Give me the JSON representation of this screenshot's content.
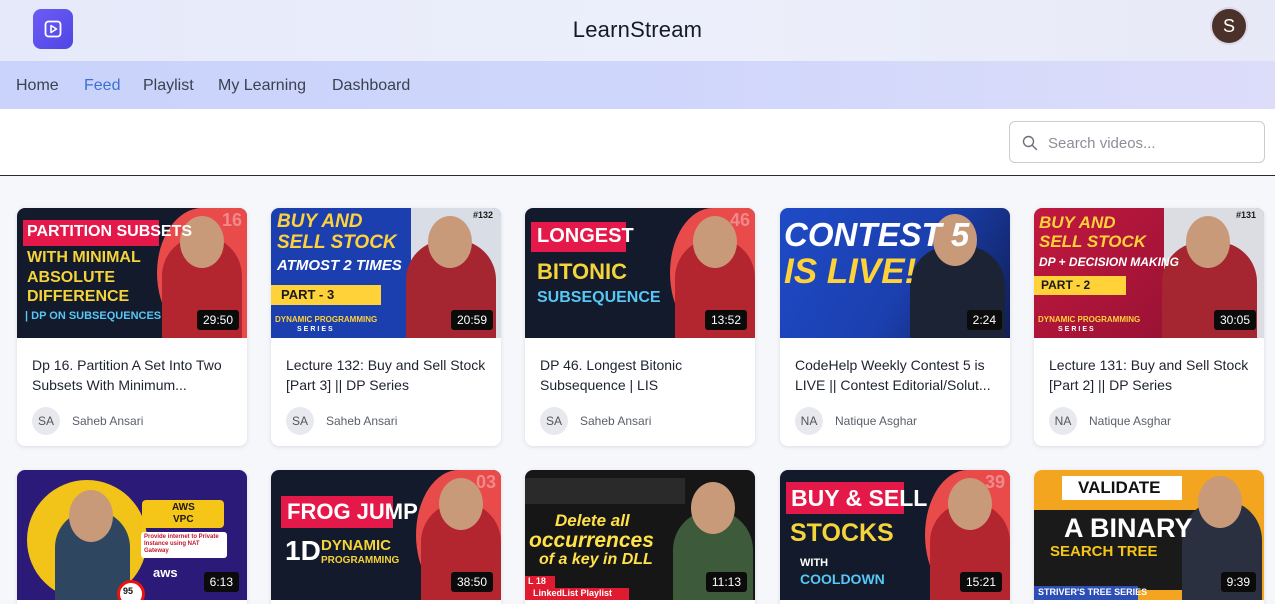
{
  "app": {
    "title": "LearnStream",
    "user_initial": "S"
  },
  "nav": {
    "items": [
      "Home",
      "Feed",
      "Playlist",
      "My Learning",
      "Dashboard"
    ],
    "active": "Feed"
  },
  "search": {
    "placeholder": "Search videos..."
  },
  "icons": {
    "logo": "play-square-icon",
    "search": "search-icon"
  },
  "colors": {
    "brand": "#5b4cf0",
    "nav_active": "#3d6fd6"
  },
  "videos": [
    {
      "title": "Dp 16. Partition A Set Into Two Subsets With Minimum...",
      "duration": "29:50",
      "channel_initials": "SA",
      "channel": "Saheb Ansari",
      "thumb_text": [
        "PARTITION SUBSETS",
        "WITH MINIMAL",
        "ABSOLUTE",
        "DIFFERENCE",
        "| DP ON SUBSEQUENCES"
      ],
      "thumb_num": "16"
    },
    {
      "title": "Lecture 132: Buy and Sell Stock [Part 3] || DP Series",
      "duration": "20:59",
      "channel_initials": "SA",
      "channel": "Saheb Ansari",
      "thumb_text": [
        "BUY AND",
        "SELL STOCK",
        "ATMOST 2 TIMES",
        "PART - 3",
        "DYNAMIC PROGRAMMING",
        "SERIES"
      ],
      "thumb_num": "#132"
    },
    {
      "title": "DP 46. Longest Bitonic Subsequence | LIS",
      "duration": "13:52",
      "channel_initials": "SA",
      "channel": "Saheb Ansari",
      "thumb_text": [
        "LONGEST",
        "BITONIC",
        "SUBSEQUENCE"
      ],
      "thumb_num": "46"
    },
    {
      "title": "CodeHelp Weekly Contest 5 is LIVE || Contest Editorial/Solut...",
      "duration": "2:24",
      "channel_initials": "NA",
      "channel": "Natique Asghar",
      "thumb_text": [
        "CONTEST 5",
        "IS LIVE!"
      ],
      "thumb_num": ""
    },
    {
      "title": "Lecture 131: Buy and Sell Stock [Part 2] || DP Series",
      "duration": "30:05",
      "channel_initials": "NA",
      "channel": "Natique Asghar",
      "thumb_text": [
        "BUY AND",
        "SELL STOCK",
        "DP + DECISION MAKING",
        "PART - 2",
        "DYNAMIC PROGRAMMING",
        "SERIES"
      ],
      "thumb_num": "#131"
    },
    {
      "title": "",
      "duration": "6:13",
      "channel_initials": "",
      "channel": "",
      "thumb_text": [
        "AWS",
        "VPC",
        "Provide internet to Private Instance using NAT Gateway",
        "aws",
        "95"
      ],
      "thumb_num": ""
    },
    {
      "title": "",
      "duration": "38:50",
      "channel_initials": "",
      "channel": "",
      "thumb_text": [
        "FROG JUMP",
        "1D",
        "DYNAMIC",
        "PROGRAMMING"
      ],
      "thumb_num": "03"
    },
    {
      "title": "",
      "duration": "11:13",
      "channel_initials": "",
      "channel": "",
      "thumb_text": [
        "Delete all",
        "occurrences",
        "of a key in DLL",
        "L 18",
        "LinkedList Playlist"
      ],
      "thumb_num": ""
    },
    {
      "title": "",
      "duration": "15:21",
      "channel_initials": "",
      "channel": "",
      "thumb_text": [
        "BUY & SELL",
        "STOCKS",
        "WITH",
        "COOLDOWN"
      ],
      "thumb_num": "39"
    },
    {
      "title": "",
      "duration": "9:39",
      "channel_initials": "",
      "channel": "",
      "thumb_text": [
        "VALIDATE",
        "A BINARY",
        "SEARCH TREE",
        "STRIVER'S TREE SERIES"
      ],
      "thumb_num": ""
    }
  ]
}
